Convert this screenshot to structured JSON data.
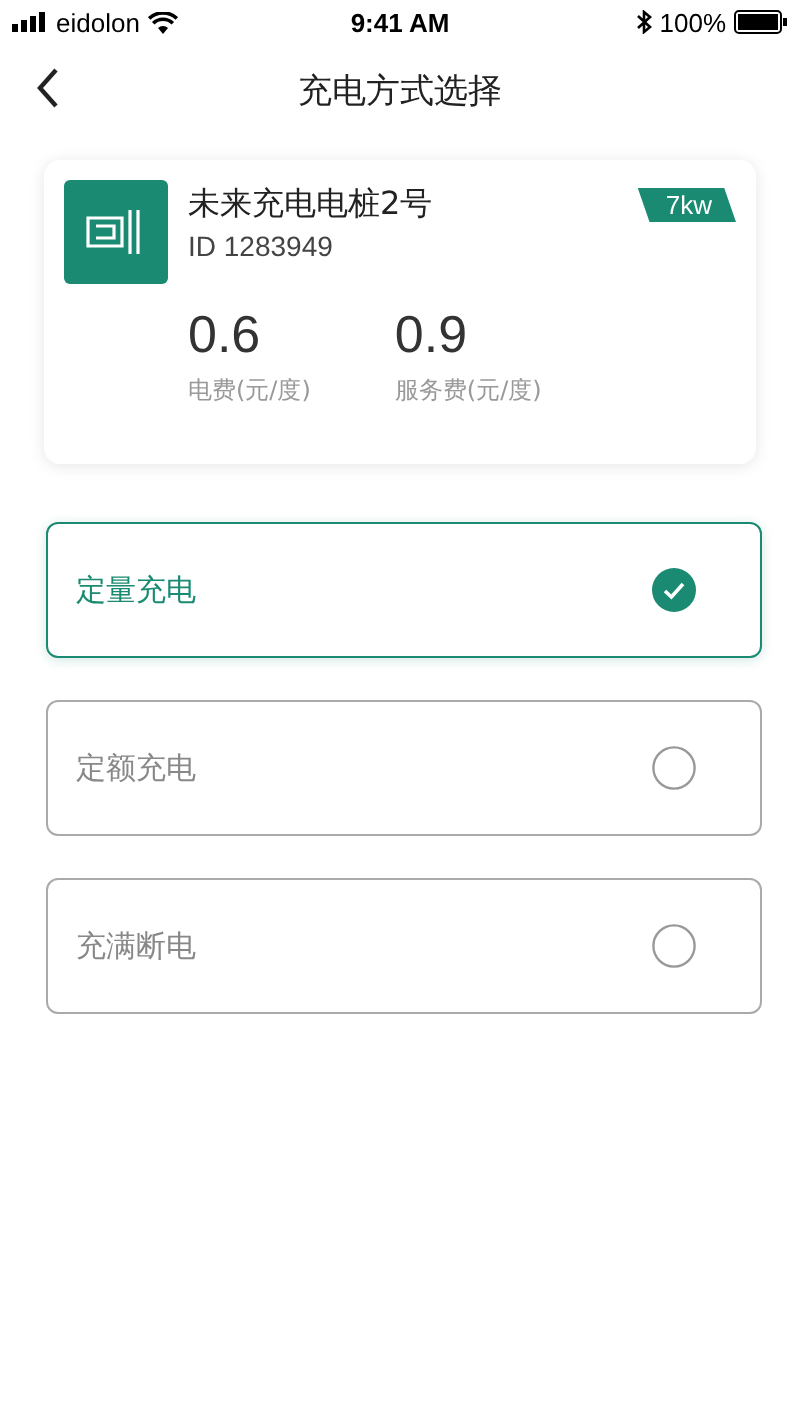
{
  "status_bar": {
    "carrier": "eidolon",
    "time": "9:41 AM",
    "battery": "100%"
  },
  "nav": {
    "title": "充电方式选择"
  },
  "station": {
    "name": "未来充电电桩2号",
    "id": "ID 1283949",
    "power": "7kw",
    "fees": [
      {
        "value": "0.6",
        "label": "电费(元/度)"
      },
      {
        "value": "0.9",
        "label": "服务费(元/度)"
      }
    ]
  },
  "options": [
    {
      "label": "定量充电",
      "selected": true
    },
    {
      "label": "定额充电",
      "selected": false
    },
    {
      "label": "充满断电",
      "selected": false
    }
  ]
}
